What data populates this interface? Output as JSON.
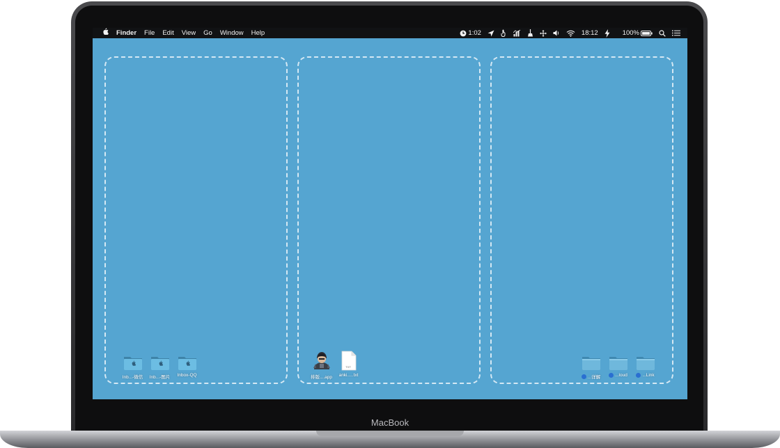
{
  "device": {
    "brand_label": "MacBook"
  },
  "menubar": {
    "apple_icon": "apple-icon",
    "app_name": "Finder",
    "menus": [
      "File",
      "Edit",
      "View",
      "Go",
      "Window",
      "Help"
    ],
    "status": {
      "timer": "1:02",
      "clock": "18:12",
      "battery_percent": "100%"
    }
  },
  "desktop": {
    "background_color": "#55a5d1",
    "zones": [
      {
        "icons": [
          {
            "label": "Inb...-微信",
            "icon": "folder-apple-icon"
          },
          {
            "label": "Inb...-图片",
            "icon": "folder-apple-icon"
          },
          {
            "label": "Inbox-QQ",
            "icon": "folder-apple-icon"
          }
        ]
      },
      {
        "icons": [
          {
            "label": "排版....app",
            "icon": "app-character-icon"
          },
          {
            "label": "anki.....txt",
            "icon": "txt-file-icon",
            "badge": "TXT"
          }
        ]
      },
      {
        "icons": [
          {
            "label": "...详解",
            "icon": "folder-icon"
          },
          {
            "label": "...loud",
            "icon": "folder-icon"
          },
          {
            "label": "...Link",
            "icon": "folder-icon"
          }
        ]
      }
    ]
  }
}
